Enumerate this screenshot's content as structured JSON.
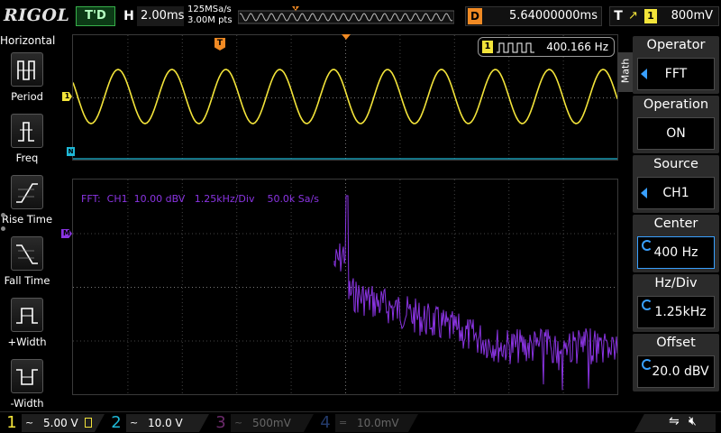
{
  "brand": "RIGOL",
  "top": {
    "trigger_status": "T'D",
    "horizontal_label": "H",
    "timebase": "2.00ms",
    "sample_rate": "125MSa/s",
    "memory_depth": "3.00M pts",
    "trigger_marker": "T",
    "delay_label": "D",
    "delay_value": "5.64000000ms",
    "trigger_label": "T",
    "trigger_edge": "↗",
    "trigger_channel": "1",
    "trigger_level": "800mV"
  },
  "left": {
    "title": "Horizontal",
    "items": [
      {
        "label": "Period"
      },
      {
        "label": "Freq"
      },
      {
        "label": "Rise Time"
      },
      {
        "label": "Fall Time"
      },
      {
        "label": "+Width"
      },
      {
        "label": "-Width"
      }
    ]
  },
  "upper_window": {
    "channel_marker": "1",
    "math_marker": "N",
    "trigger_pos_marker": "T",
    "freq_channel": "1",
    "frequency": "400.166 Hz"
  },
  "lower_window": {
    "fft_info": "FFT:  CH1  10.00 dBV   1.25kHz/Div    50.0k Sa/s",
    "math_marker": "M"
  },
  "right_menu": {
    "tab": "Math",
    "items": [
      {
        "header": "Operator",
        "value": "FFT"
      },
      {
        "header": "Operation",
        "value": "ON"
      },
      {
        "header": "Source",
        "value": "CH1"
      },
      {
        "header": "Center",
        "value": "400 Hz"
      },
      {
        "header": "Hz/Div",
        "value": "1.25kHz"
      },
      {
        "header": "Offset",
        "value": "20.0 dBV"
      }
    ]
  },
  "channels": [
    {
      "num": "1",
      "coupling": "~",
      "scale": "5.00 V",
      "color": "#f3e43a",
      "enabled": true
    },
    {
      "num": "2",
      "coupling": "~",
      "scale": "10.0 V",
      "color": "#1fb8d6",
      "enabled": true
    },
    {
      "num": "3",
      "coupling": "~",
      "scale": "500mV",
      "color": "#6a2a6a",
      "enabled": false
    },
    {
      "num": "4",
      "coupling": "=",
      "scale": "10.0mV",
      "color": "#233a6a",
      "enabled": false
    }
  ],
  "colors": {
    "ch1": "#f3e43a",
    "ch2": "#1fb8d6",
    "math": "#8a34e2",
    "accent": "#39a0ff",
    "trigger": "#f08a24"
  }
}
